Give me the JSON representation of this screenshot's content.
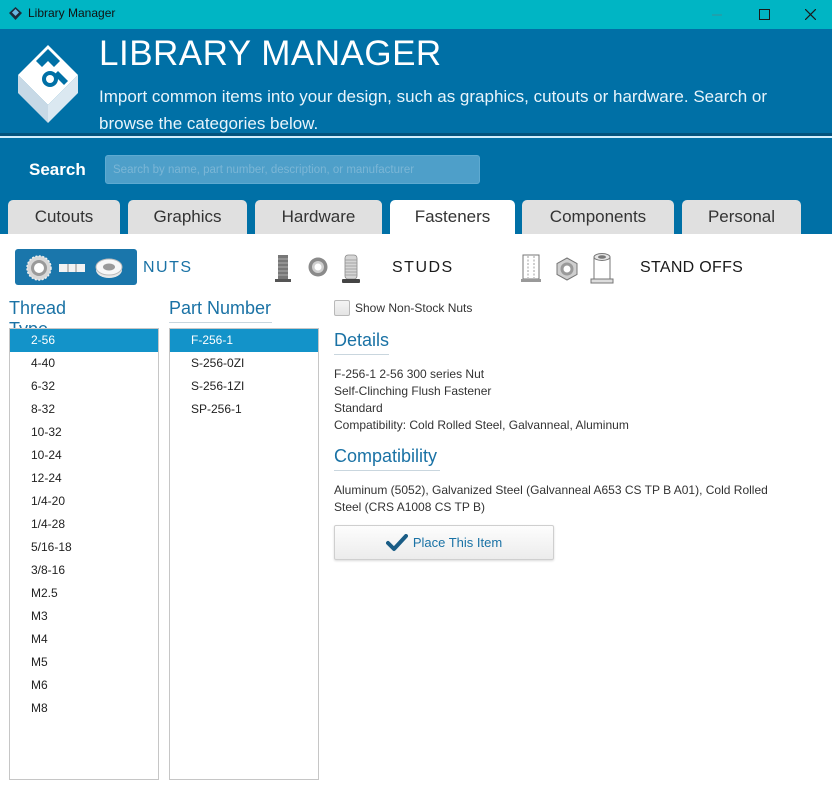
{
  "window": {
    "title": "Library Manager",
    "controls": {
      "minimize": "minimize",
      "maximize": "maximize",
      "close": "close"
    }
  },
  "header": {
    "title": "LIBRARY MANAGER",
    "subtitle": "Import common items into your design, such as graphics, cutouts or hardware. Search or browse the categories below."
  },
  "search": {
    "label": "Search",
    "placeholder": "Search by name, part number, description, or manufacturer",
    "value": ""
  },
  "tabs": [
    {
      "label": "Cutouts",
      "active": false
    },
    {
      "label": "Graphics",
      "active": false
    },
    {
      "label": "Hardware",
      "active": false
    },
    {
      "label": "Fasteners",
      "active": true
    },
    {
      "label": "Components",
      "active": false
    },
    {
      "label": "Personal",
      "active": false
    }
  ],
  "categories": [
    {
      "label": "NUTS",
      "selected": true,
      "icons": [
        "flush-nut-icon",
        "nut-side-icon",
        "round-nut-icon"
      ]
    },
    {
      "label": "STUDS",
      "selected": false,
      "icons": [
        "stud-side-icon",
        "stud-top-icon",
        "threaded-stud-icon"
      ]
    },
    {
      "label": "STAND OFFS",
      "selected": false,
      "icons": [
        "standoff-section-icon",
        "hex-standoff-icon",
        "standoff-side-icon"
      ]
    }
  ],
  "thread_type": {
    "heading": "Thread Type",
    "items": [
      "2-56",
      "4-40",
      "6-32",
      "8-32",
      "10-32",
      "10-24",
      "12-24",
      "1/4-20",
      "1/4-28",
      "5/16-18",
      "3/8-16",
      "M2.5",
      "M3",
      "M4",
      "M5",
      "M6",
      "M8"
    ],
    "selected": "2-56"
  },
  "part_number": {
    "heading": "Part Number",
    "items": [
      "F-256-1",
      "S-256-0ZI",
      "S-256-1ZI",
      "SP-256-1"
    ],
    "selected": "F-256-1"
  },
  "show_non_stock": {
    "label": "Show Non-Stock Nuts",
    "checked": false
  },
  "details": {
    "heading": "Details",
    "lines": [
      "F-256-1 2-56 300 series Nut",
      "Self-Clinching Flush Fastener",
      "Standard",
      "Compatibility: Cold Rolled Steel, Galvanneal, Aluminum"
    ]
  },
  "compatibility": {
    "heading": "Compatibility",
    "text": "Aluminum (5052), Galvanized Steel (Galvanneal A653 CS TP B A01), Cold Rolled Steel (CRS A1008 CS TP B)"
  },
  "place_button": {
    "label": "Place This Item",
    "icon": "checkmark-icon"
  },
  "colors": {
    "titlebar": "#00b5c4",
    "header": "#0070a6",
    "accent": "#1a72a5",
    "selection": "#1393c9",
    "tab_inactive": "#e0e0e0"
  }
}
